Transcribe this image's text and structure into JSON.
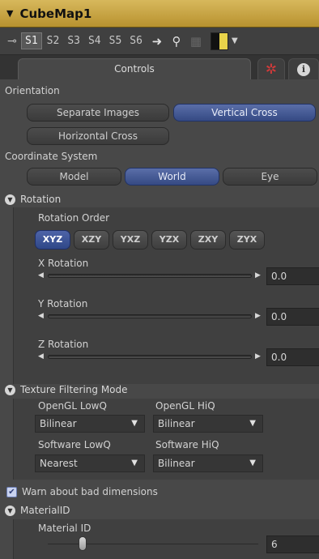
{
  "header": {
    "title": "CubeMap1"
  },
  "toolbar": {
    "slots": [
      "S1",
      "S2",
      "S3",
      "S4",
      "S5",
      "S6"
    ]
  },
  "tabs": {
    "controls": "Controls"
  },
  "orientation": {
    "label": "Orientation",
    "options": [
      "Separate Images",
      "Vertical Cross",
      "Horizontal Cross"
    ],
    "selected": "Vertical Cross"
  },
  "coordinate_system": {
    "label": "Coordinate System",
    "options": [
      "Model",
      "World",
      "Eye"
    ],
    "selected": "World"
  },
  "rotation": {
    "section": "Rotation",
    "order_label": "Rotation Order",
    "orders": [
      "XYZ",
      "XZY",
      "YXZ",
      "YZX",
      "ZXY",
      "ZYX"
    ],
    "selected_order": "XYZ",
    "x": {
      "label": "X Rotation",
      "value": "0.0"
    },
    "y": {
      "label": "Y Rotation",
      "value": "0.0"
    },
    "z": {
      "label": "Z Rotation",
      "value": "0.0"
    }
  },
  "texture": {
    "section": "Texture Filtering Mode",
    "opengl_lowq": {
      "label": "OpenGL LowQ",
      "value": "Bilinear"
    },
    "opengl_hiq": {
      "label": "OpenGL HiQ",
      "value": "Bilinear"
    },
    "software_lowq": {
      "label": "Software LowQ",
      "value": "Nearest"
    },
    "software_hiq": {
      "label": "Software HiQ",
      "value": "Bilinear"
    }
  },
  "warn": {
    "label": "Warn about bad dimensions",
    "checked": true
  },
  "material": {
    "section": "MaterialID",
    "label": "Material ID",
    "value": "6"
  }
}
